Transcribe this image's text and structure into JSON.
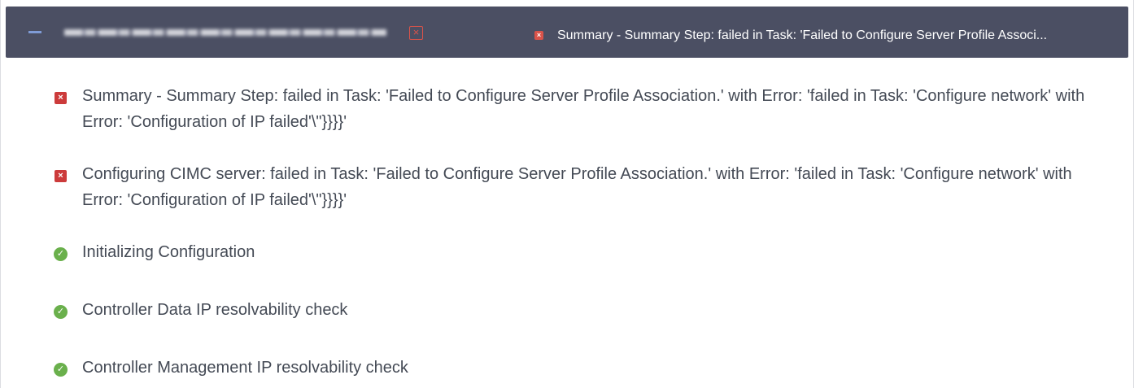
{
  "header": {
    "host_name": "",
    "summary": "Summary - Summary Step: failed in Task: 'Failed to Configure Server Profile Associ..."
  },
  "steps": [
    {
      "status": "failed",
      "icon": "fail-icon",
      "text": "Summary - Summary Step: failed in Task: 'Failed to Configure Server Profile Association.' with Error: 'failed in Task: 'Configure network' with Error: 'Configuration of IP failed'\\\"}}}}'"
    },
    {
      "status": "failed",
      "icon": "fail-icon",
      "text": "Configuring CIMC server: failed in Task: 'Failed to Configure Server Profile Association.' with Error: 'failed in Task: 'Configure network' with Error: 'Configuration of IP failed'\\\"}}}}'"
    },
    {
      "status": "success",
      "icon": "check-circle-icon",
      "text": "Initializing Configuration"
    },
    {
      "status": "success",
      "icon": "check-circle-icon",
      "text": "Controller Data IP resolvability check"
    },
    {
      "status": "success",
      "icon": "check-circle-icon",
      "text": "Controller Management IP resolvability check"
    }
  ],
  "colors": {
    "header_bg": "#4b4f63",
    "error": "#cc3b3b",
    "success": "#6ab04c",
    "text": "#444a55"
  }
}
